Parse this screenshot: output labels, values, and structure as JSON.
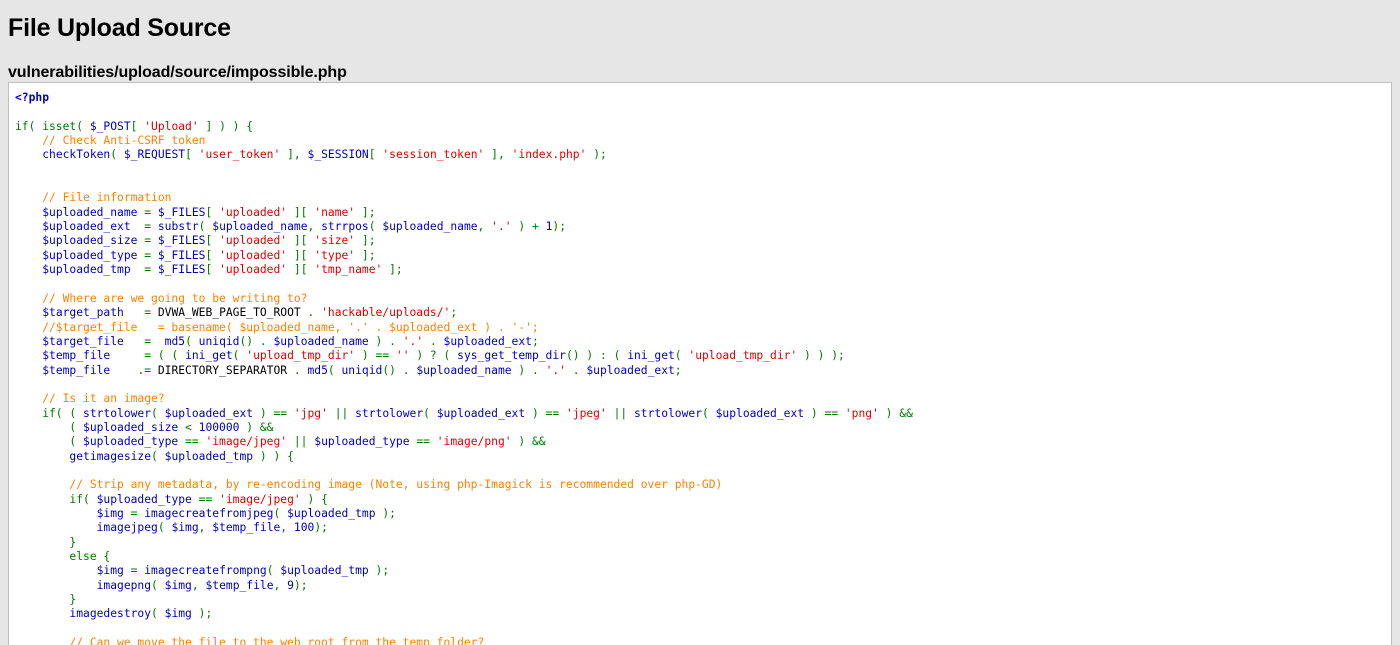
{
  "page": {
    "title": "File Upload Source",
    "file_path": "vulnerabilities/upload/source/impossible.php",
    "background_color": "#e6e6e6"
  },
  "code_box": {
    "background_color": "#ffffff",
    "border_color": "#bfbfbf",
    "language": "php"
  },
  "syntax_colors": {
    "tag": "#0000bb",
    "comment": "#ff8000",
    "keyword": "#007700",
    "string": "#dd0000",
    "variable": "#0000bb",
    "function": "#0000bb",
    "number": "#0000bb",
    "default": "#000000"
  },
  "code_lines": [
    [
      {
        "t": "<?php",
        "c": "tag"
      }
    ],
    [],
    [
      {
        "t": "if( isset( ",
        "c": "keyword"
      },
      {
        "t": "$_POST",
        "c": "var"
      },
      {
        "t": "[ ",
        "c": "keyword"
      },
      {
        "t": "'Upload'",
        "c": "string"
      },
      {
        "t": " ] ) ) {",
        "c": "keyword"
      }
    ],
    [
      {
        "t": "    // Check Anti-CSRF token",
        "c": "comment"
      }
    ],
    [
      {
        "t": "    ",
        "c": "default"
      },
      {
        "t": "checkToken",
        "c": "func"
      },
      {
        "t": "( ",
        "c": "keyword"
      },
      {
        "t": "$_REQUEST",
        "c": "var"
      },
      {
        "t": "[ ",
        "c": "keyword"
      },
      {
        "t": "'user_token'",
        "c": "string"
      },
      {
        "t": " ], ",
        "c": "keyword"
      },
      {
        "t": "$_SESSION",
        "c": "var"
      },
      {
        "t": "[ ",
        "c": "keyword"
      },
      {
        "t": "'session_token'",
        "c": "string"
      },
      {
        "t": " ], ",
        "c": "keyword"
      },
      {
        "t": "'index.php'",
        "c": "string"
      },
      {
        "t": " );",
        "c": "keyword"
      }
    ],
    [],
    [],
    [
      {
        "t": "    // File information",
        "c": "comment"
      }
    ],
    [
      {
        "t": "    ",
        "c": "default"
      },
      {
        "t": "$uploaded_name",
        "c": "var"
      },
      {
        "t": " = ",
        "c": "keyword"
      },
      {
        "t": "$_FILES",
        "c": "var"
      },
      {
        "t": "[ ",
        "c": "keyword"
      },
      {
        "t": "'uploaded'",
        "c": "string"
      },
      {
        "t": " ][ ",
        "c": "keyword"
      },
      {
        "t": "'name'",
        "c": "string"
      },
      {
        "t": " ];",
        "c": "keyword"
      }
    ],
    [
      {
        "t": "    ",
        "c": "default"
      },
      {
        "t": "$uploaded_ext",
        "c": "var"
      },
      {
        "t": "  = ",
        "c": "keyword"
      },
      {
        "t": "substr",
        "c": "func"
      },
      {
        "t": "( ",
        "c": "keyword"
      },
      {
        "t": "$uploaded_name",
        "c": "var"
      },
      {
        "t": ", ",
        "c": "keyword"
      },
      {
        "t": "strrpos",
        "c": "func"
      },
      {
        "t": "( ",
        "c": "keyword"
      },
      {
        "t": "$uploaded_name",
        "c": "var"
      },
      {
        "t": ", ",
        "c": "keyword"
      },
      {
        "t": "'.'",
        "c": "string"
      },
      {
        "t": " ) + ",
        "c": "keyword"
      },
      {
        "t": "1",
        "c": "number"
      },
      {
        "t": ");",
        "c": "keyword"
      }
    ],
    [
      {
        "t": "    ",
        "c": "default"
      },
      {
        "t": "$uploaded_size",
        "c": "var"
      },
      {
        "t": " = ",
        "c": "keyword"
      },
      {
        "t": "$_FILES",
        "c": "var"
      },
      {
        "t": "[ ",
        "c": "keyword"
      },
      {
        "t": "'uploaded'",
        "c": "string"
      },
      {
        "t": " ][ ",
        "c": "keyword"
      },
      {
        "t": "'size'",
        "c": "string"
      },
      {
        "t": " ];",
        "c": "keyword"
      }
    ],
    [
      {
        "t": "    ",
        "c": "default"
      },
      {
        "t": "$uploaded_type",
        "c": "var"
      },
      {
        "t": " = ",
        "c": "keyword"
      },
      {
        "t": "$_FILES",
        "c": "var"
      },
      {
        "t": "[ ",
        "c": "keyword"
      },
      {
        "t": "'uploaded'",
        "c": "string"
      },
      {
        "t": " ][ ",
        "c": "keyword"
      },
      {
        "t": "'type'",
        "c": "string"
      },
      {
        "t": " ];",
        "c": "keyword"
      }
    ],
    [
      {
        "t": "    ",
        "c": "default"
      },
      {
        "t": "$uploaded_tmp",
        "c": "var"
      },
      {
        "t": "  = ",
        "c": "keyword"
      },
      {
        "t": "$_FILES",
        "c": "var"
      },
      {
        "t": "[ ",
        "c": "keyword"
      },
      {
        "t": "'uploaded'",
        "c": "string"
      },
      {
        "t": " ][ ",
        "c": "keyword"
      },
      {
        "t": "'tmp_name'",
        "c": "string"
      },
      {
        "t": " ];",
        "c": "keyword"
      }
    ],
    [],
    [
      {
        "t": "    // Where are we going to be writing to?",
        "c": "comment"
      }
    ],
    [
      {
        "t": "    ",
        "c": "default"
      },
      {
        "t": "$target_path",
        "c": "var"
      },
      {
        "t": "   = ",
        "c": "keyword"
      },
      {
        "t": "DVWA_WEB_PAGE_TO_ROOT",
        "c": "default"
      },
      {
        "t": " . ",
        "c": "keyword"
      },
      {
        "t": "'hackable/uploads/'",
        "c": "string"
      },
      {
        "t": ";",
        "c": "keyword"
      }
    ],
    [
      {
        "t": "    //$target_file   = basename( $uploaded_name, '.' . $uploaded_ext ) . '-';",
        "c": "comment"
      }
    ],
    [
      {
        "t": "    ",
        "c": "default"
      },
      {
        "t": "$target_file",
        "c": "var"
      },
      {
        "t": "   =  ",
        "c": "keyword"
      },
      {
        "t": "md5",
        "c": "func"
      },
      {
        "t": "( ",
        "c": "keyword"
      },
      {
        "t": "uniqid",
        "c": "func"
      },
      {
        "t": "() . ",
        "c": "keyword"
      },
      {
        "t": "$uploaded_name",
        "c": "var"
      },
      {
        "t": " ) . ",
        "c": "keyword"
      },
      {
        "t": "'.'",
        "c": "string"
      },
      {
        "t": " . ",
        "c": "keyword"
      },
      {
        "t": "$uploaded_ext",
        "c": "var"
      },
      {
        "t": ";",
        "c": "keyword"
      }
    ],
    [
      {
        "t": "    ",
        "c": "default"
      },
      {
        "t": "$temp_file",
        "c": "var"
      },
      {
        "t": "     = ( ( ",
        "c": "keyword"
      },
      {
        "t": "ini_get",
        "c": "func"
      },
      {
        "t": "( ",
        "c": "keyword"
      },
      {
        "t": "'upload_tmp_dir'",
        "c": "string"
      },
      {
        "t": " ) == ",
        "c": "keyword"
      },
      {
        "t": "''",
        "c": "string"
      },
      {
        "t": " ) ? ( ",
        "c": "keyword"
      },
      {
        "t": "sys_get_temp_dir",
        "c": "func"
      },
      {
        "t": "() ) : ( ",
        "c": "keyword"
      },
      {
        "t": "ini_get",
        "c": "func"
      },
      {
        "t": "( ",
        "c": "keyword"
      },
      {
        "t": "'upload_tmp_dir'",
        "c": "string"
      },
      {
        "t": " ) ) );",
        "c": "keyword"
      }
    ],
    [
      {
        "t": "    ",
        "c": "default"
      },
      {
        "t": "$temp_file",
        "c": "var"
      },
      {
        "t": "    .= ",
        "c": "keyword"
      },
      {
        "t": "DIRECTORY_SEPARATOR",
        "c": "default"
      },
      {
        "t": " . ",
        "c": "keyword"
      },
      {
        "t": "md5",
        "c": "func"
      },
      {
        "t": "( ",
        "c": "keyword"
      },
      {
        "t": "uniqid",
        "c": "func"
      },
      {
        "t": "() . ",
        "c": "keyword"
      },
      {
        "t": "$uploaded_name",
        "c": "var"
      },
      {
        "t": " ) . ",
        "c": "keyword"
      },
      {
        "t": "'.'",
        "c": "string"
      },
      {
        "t": " . ",
        "c": "keyword"
      },
      {
        "t": "$uploaded_ext",
        "c": "var"
      },
      {
        "t": ";",
        "c": "keyword"
      }
    ],
    [],
    [
      {
        "t": "    // Is it an image?",
        "c": "comment"
      }
    ],
    [
      {
        "t": "    if( ( ",
        "c": "keyword"
      },
      {
        "t": "strtolower",
        "c": "func"
      },
      {
        "t": "( ",
        "c": "keyword"
      },
      {
        "t": "$uploaded_ext",
        "c": "var"
      },
      {
        "t": " ) == ",
        "c": "keyword"
      },
      {
        "t": "'jpg'",
        "c": "string"
      },
      {
        "t": " || ",
        "c": "keyword"
      },
      {
        "t": "strtolower",
        "c": "func"
      },
      {
        "t": "( ",
        "c": "keyword"
      },
      {
        "t": "$uploaded_ext",
        "c": "var"
      },
      {
        "t": " ) == ",
        "c": "keyword"
      },
      {
        "t": "'jpeg'",
        "c": "string"
      },
      {
        "t": " || ",
        "c": "keyword"
      },
      {
        "t": "strtolower",
        "c": "func"
      },
      {
        "t": "( ",
        "c": "keyword"
      },
      {
        "t": "$uploaded_ext",
        "c": "var"
      },
      {
        "t": " ) == ",
        "c": "keyword"
      },
      {
        "t": "'png'",
        "c": "string"
      },
      {
        "t": " ) &&",
        "c": "keyword"
      }
    ],
    [
      {
        "t": "        ( ",
        "c": "keyword"
      },
      {
        "t": "$uploaded_size",
        "c": "var"
      },
      {
        "t": " < ",
        "c": "keyword"
      },
      {
        "t": "100000",
        "c": "number"
      },
      {
        "t": " ) &&",
        "c": "keyword"
      }
    ],
    [
      {
        "t": "        ( ",
        "c": "keyword"
      },
      {
        "t": "$uploaded_type",
        "c": "var"
      },
      {
        "t": " == ",
        "c": "keyword"
      },
      {
        "t": "'image/jpeg'",
        "c": "string"
      },
      {
        "t": " || ",
        "c": "keyword"
      },
      {
        "t": "$uploaded_type",
        "c": "var"
      },
      {
        "t": " == ",
        "c": "keyword"
      },
      {
        "t": "'image/png'",
        "c": "string"
      },
      {
        "t": " ) &&",
        "c": "keyword"
      }
    ],
    [
      {
        "t": "        ",
        "c": "default"
      },
      {
        "t": "getimagesize",
        "c": "func"
      },
      {
        "t": "( ",
        "c": "keyword"
      },
      {
        "t": "$uploaded_tmp",
        "c": "var"
      },
      {
        "t": " ) ) {",
        "c": "keyword"
      }
    ],
    [],
    [
      {
        "t": "        // Strip any metadata, by re-encoding image (Note, using php-Imagick is recommended over php-GD)",
        "c": "comment"
      }
    ],
    [
      {
        "t": "        if( ",
        "c": "keyword"
      },
      {
        "t": "$uploaded_type",
        "c": "var"
      },
      {
        "t": " == ",
        "c": "keyword"
      },
      {
        "t": "'image/jpeg'",
        "c": "string"
      },
      {
        "t": " ) {",
        "c": "keyword"
      }
    ],
    [
      {
        "t": "            ",
        "c": "default"
      },
      {
        "t": "$img",
        "c": "var"
      },
      {
        "t": " = ",
        "c": "keyword"
      },
      {
        "t": "imagecreatefromjpeg",
        "c": "func"
      },
      {
        "t": "( ",
        "c": "keyword"
      },
      {
        "t": "$uploaded_tmp",
        "c": "var"
      },
      {
        "t": " );",
        "c": "keyword"
      }
    ],
    [
      {
        "t": "            ",
        "c": "default"
      },
      {
        "t": "imagejpeg",
        "c": "func"
      },
      {
        "t": "( ",
        "c": "keyword"
      },
      {
        "t": "$img",
        "c": "var"
      },
      {
        "t": ", ",
        "c": "keyword"
      },
      {
        "t": "$temp_file",
        "c": "var"
      },
      {
        "t": ", ",
        "c": "keyword"
      },
      {
        "t": "100",
        "c": "number"
      },
      {
        "t": ");",
        "c": "keyword"
      }
    ],
    [
      {
        "t": "        }",
        "c": "keyword"
      }
    ],
    [
      {
        "t": "        else {",
        "c": "keyword"
      }
    ],
    [
      {
        "t": "            ",
        "c": "default"
      },
      {
        "t": "$img",
        "c": "var"
      },
      {
        "t": " = ",
        "c": "keyword"
      },
      {
        "t": "imagecreatefrompng",
        "c": "func"
      },
      {
        "t": "( ",
        "c": "keyword"
      },
      {
        "t": "$uploaded_tmp",
        "c": "var"
      },
      {
        "t": " );",
        "c": "keyword"
      }
    ],
    [
      {
        "t": "            ",
        "c": "default"
      },
      {
        "t": "imagepng",
        "c": "func"
      },
      {
        "t": "( ",
        "c": "keyword"
      },
      {
        "t": "$img",
        "c": "var"
      },
      {
        "t": ", ",
        "c": "keyword"
      },
      {
        "t": "$temp_file",
        "c": "var"
      },
      {
        "t": ", ",
        "c": "keyword"
      },
      {
        "t": "9",
        "c": "number"
      },
      {
        "t": ");",
        "c": "keyword"
      }
    ],
    [
      {
        "t": "        }",
        "c": "keyword"
      }
    ],
    [
      {
        "t": "        ",
        "c": "default"
      },
      {
        "t": "imagedestroy",
        "c": "func"
      },
      {
        "t": "( ",
        "c": "keyword"
      },
      {
        "t": "$img",
        "c": "var"
      },
      {
        "t": " );",
        "c": "keyword"
      }
    ],
    [],
    [
      {
        "t": "        // Can we move the file to the web root from the temp folder?",
        "c": "comment"
      }
    ]
  ]
}
